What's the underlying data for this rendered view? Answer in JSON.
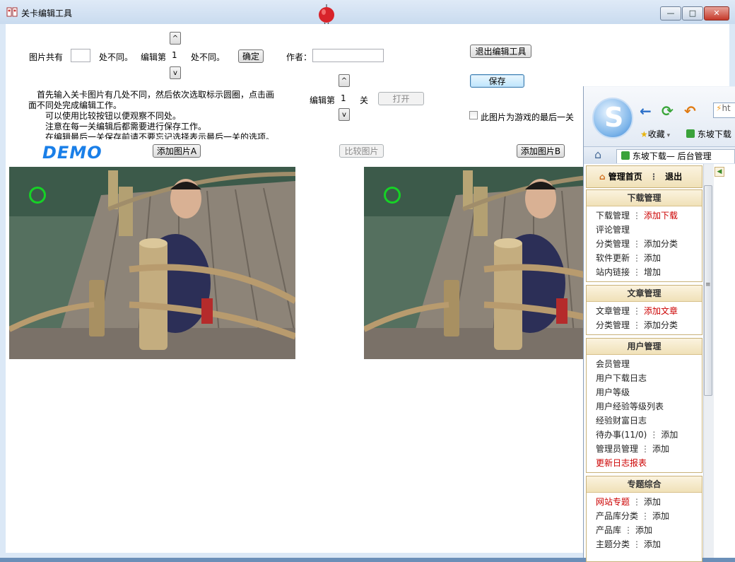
{
  "window": {
    "title": "关卡编辑工具",
    "minimize": "—",
    "maximize": "□",
    "close": "✕"
  },
  "editor": {
    "picture_total_label": "图片共有",
    "diff_count_value": "",
    "diff_suffix": "处不同。",
    "edit_index_label": "编辑第",
    "edit_index_value": "1",
    "edit_index_suffix": "处不同。",
    "up": "^",
    "down": "v",
    "confirm": "确定",
    "author_label": "作者：",
    "author_value": "",
    "level_label": "编辑第",
    "level_value": "1",
    "level_suffix": "关",
    "open": "打开",
    "exit": "退出编辑工具",
    "save": "保存",
    "last_level": "此图片为游戏的最后一关",
    "desc_lines": [
      "首先输入关卡图片有几处不同，然后依次选取标示圆圈，点击画",
      "面不同处完成编辑工作。",
      "可以使用比较按钮以便观察不同处。",
      "注意在每一关编辑后都需要进行保存工作。",
      "在编辑最后一关保存前请不要忘记选择表示最后一关的选项。"
    ],
    "demo": "DEMO",
    "add_a": "添加图片A",
    "compare": "比较图片",
    "add_b": "添加图片B"
  },
  "browser": {
    "url_prefix": "ht",
    "favorites": "收藏",
    "bookmark": "东坡下载",
    "tab_title": "东坡下载— 后台管理",
    "home": "管理首页",
    "logout": "退出",
    "sections": [
      {
        "title": "下载管理",
        "rows": [
          [
            "下载管理",
            "添加下载"
          ],
          [
            "评论管理"
          ],
          [
            "分类管理",
            "添加分类"
          ],
          [
            "软件更新",
            "添加"
          ],
          [
            "站内链接",
            "增加"
          ]
        ]
      },
      {
        "title": "文章管理",
        "rows": [
          [
            "文章管理",
            "添加文章"
          ],
          [
            "分类管理",
            "添加分类"
          ]
        ]
      },
      {
        "title": "用户管理",
        "rows": [
          [
            "会员管理"
          ],
          [
            "用户下载日志"
          ],
          [
            "用户等级"
          ],
          [
            "用户经验等级列表"
          ],
          [
            "经验财富日志"
          ],
          [
            "待办事(11/0)",
            "添加"
          ],
          [
            "管理员管理",
            "添加"
          ],
          [
            "更新日志报表"
          ]
        ]
      },
      {
        "title": "专题综合",
        "rows": [
          [
            "网站专题",
            "添加"
          ],
          [
            "产品库分类",
            "添加"
          ],
          [
            "产品库",
            "添加"
          ],
          [
            "主题分类",
            "添加"
          ]
        ]
      }
    ]
  },
  "colors": {
    "demo": "#1a7fe8",
    "circle": "#16d226",
    "accent_red": "#cc0000"
  }
}
